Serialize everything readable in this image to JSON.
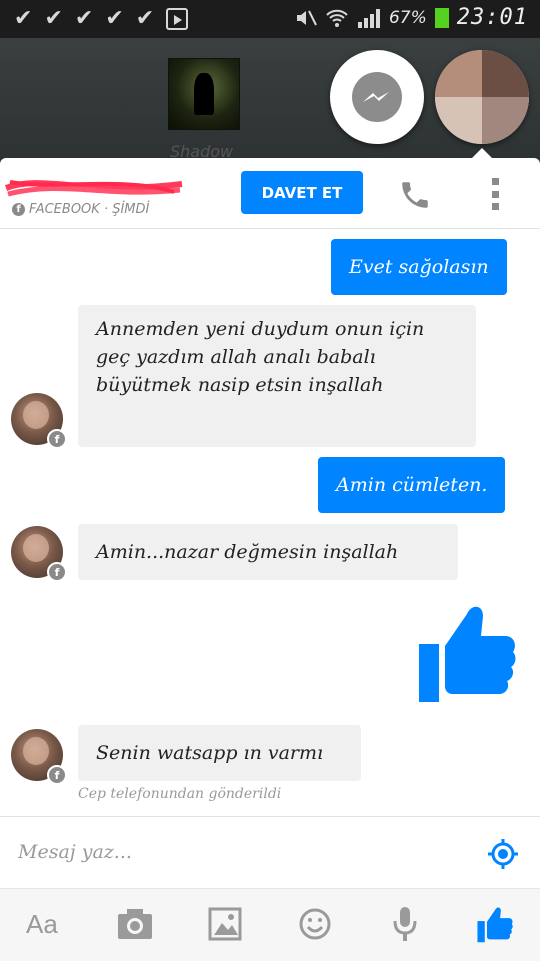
{
  "status_bar": {
    "battery_percent": "67%",
    "time": "23:01"
  },
  "background_app": {
    "label": "Shadow"
  },
  "header": {
    "subtitle": "FACEBOOK · ŞİMDİ",
    "invite_label": "DAVET ET"
  },
  "messages": [
    {
      "dir": "out",
      "text": "Evet sağolasın"
    },
    {
      "dir": "in",
      "text": "Annemden yeni duydum onun için geç yazdım allah analı babalı büyütmek nasip etsin inşallah"
    },
    {
      "dir": "out",
      "text": "Amin cümleten."
    },
    {
      "dir": "in",
      "text": "Amin...nazar değmesin inşallah"
    },
    {
      "dir": "out",
      "type": "like"
    },
    {
      "dir": "in",
      "text": "Senin watsapp ın varmı"
    }
  ],
  "sent_note": "Cep telefonundan gönderildi",
  "composer": {
    "placeholder": "Mesaj yaz..."
  },
  "toolbar": {
    "text_label": "Aa"
  },
  "colors": {
    "accent": "#0084ff",
    "incoming_bubble": "#f0f0f0",
    "battery": "#55d11f"
  }
}
